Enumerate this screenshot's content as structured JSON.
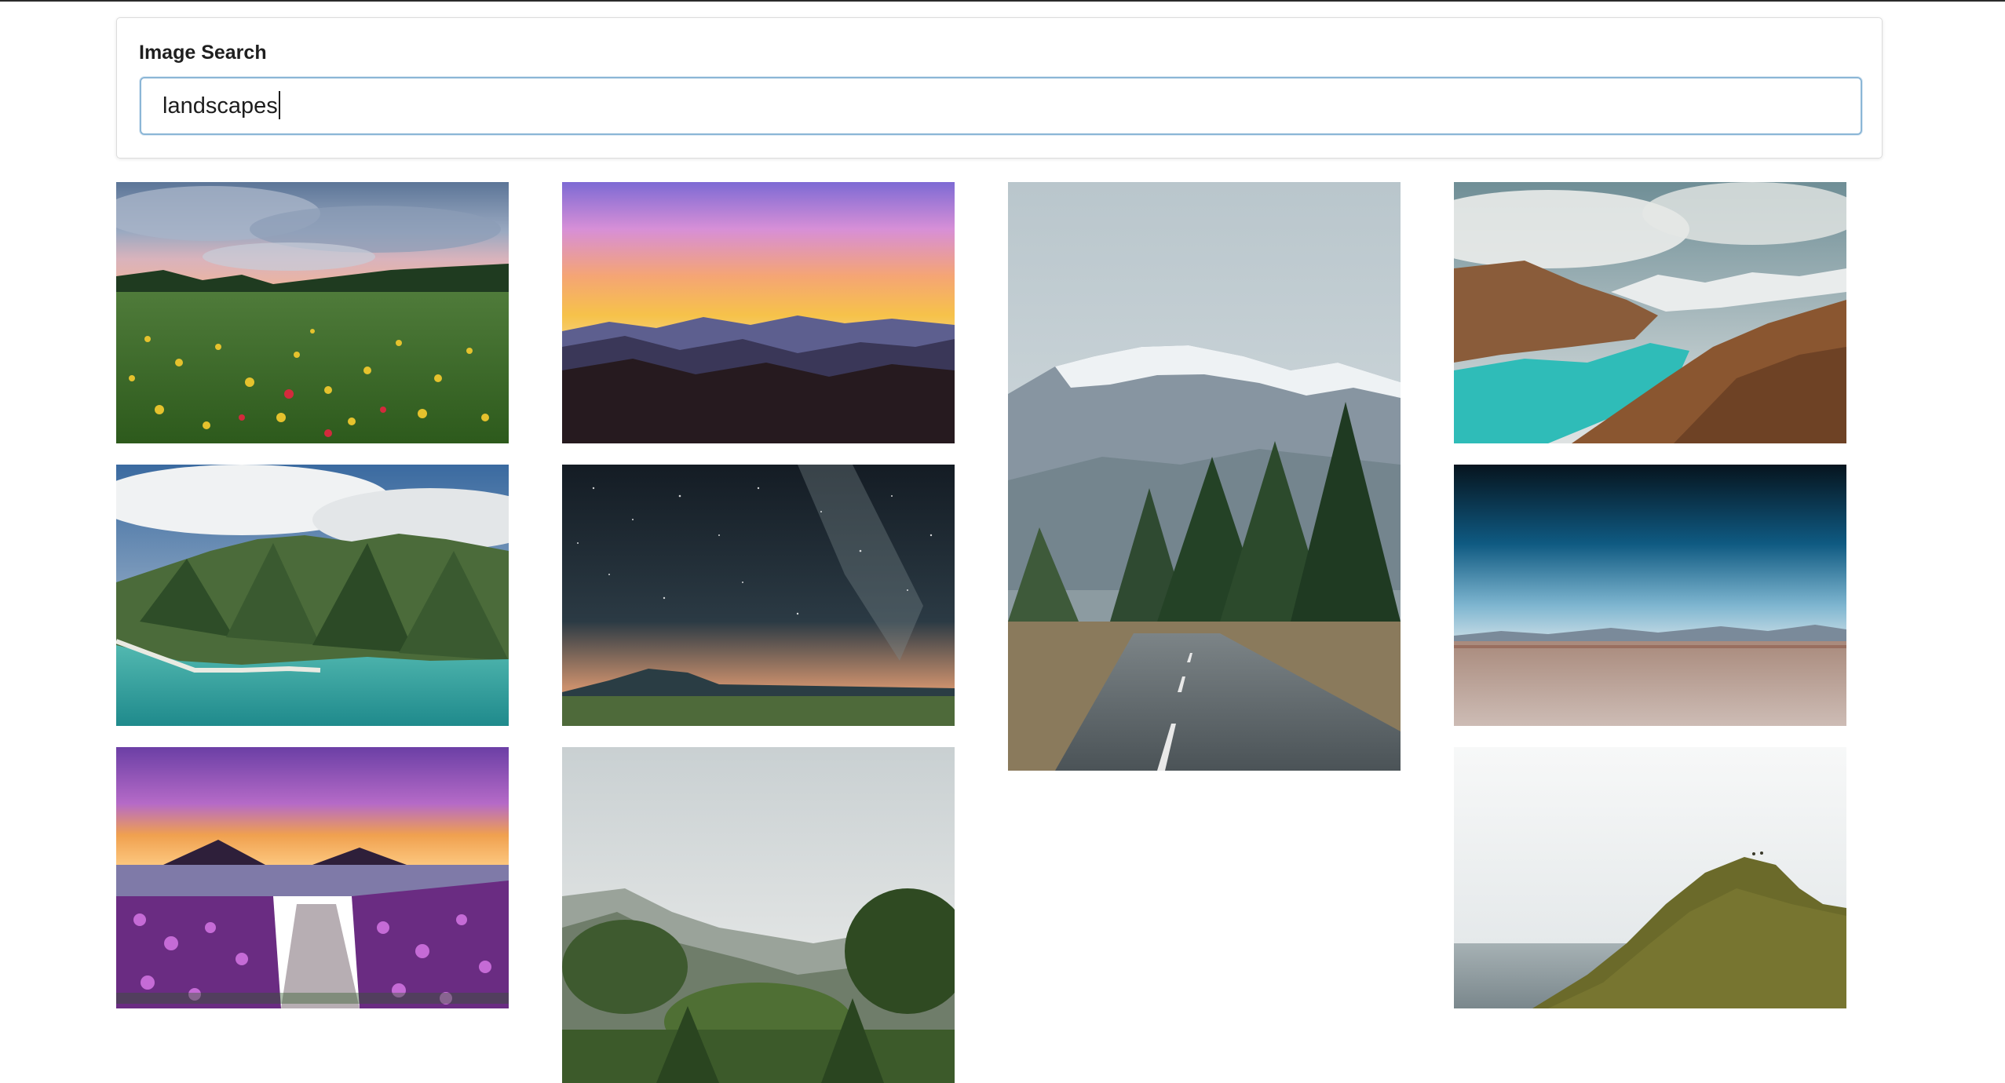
{
  "search": {
    "label": "Image Search",
    "query": "landscapes"
  },
  "results": [
    {
      "subject": "wildflower-meadow-photo"
    },
    {
      "subject": "sunset-mountain-silhouette-photo"
    },
    {
      "subject": "mountain-road-forest-photo"
    },
    {
      "subject": "turquoise-glacial-lake-photo"
    },
    {
      "subject": "green-coastal-cliffs-photo"
    },
    {
      "subject": "milky-way-night-sky-photo"
    },
    {
      "subject": "desert-plain-blue-sky-photo"
    },
    {
      "subject": "purple-flowers-lake-volcano-photo"
    },
    {
      "subject": "misty-jungle-valley-photo"
    },
    {
      "subject": "grassy-hill-over-sea-photo"
    }
  ]
}
